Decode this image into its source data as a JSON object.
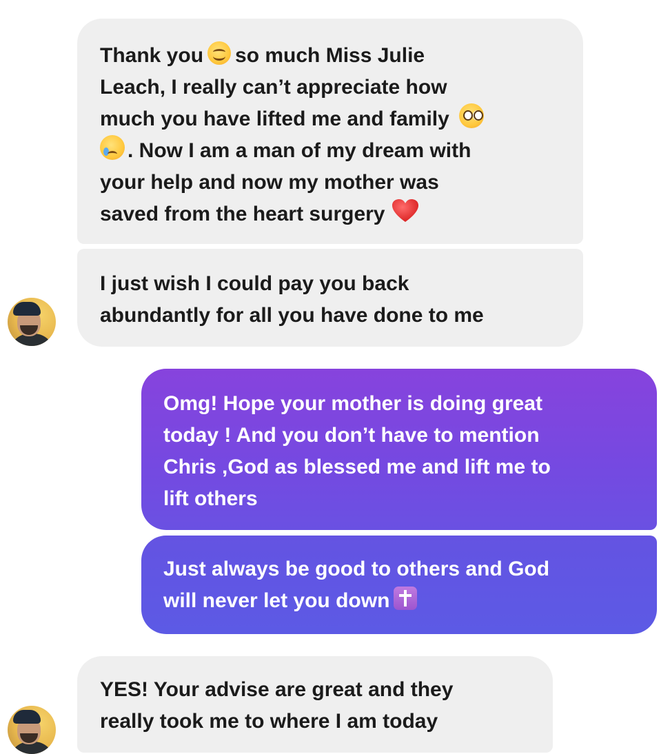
{
  "conversation": {
    "messages": [
      {
        "sender": "contact",
        "lines": [
          {
            "before": "Thank you",
            "after": "so much Miss Julie"
          },
          {
            "text": "Leach, I really can’t appreciate how"
          },
          {
            "text": "much you have lifted me and family"
          },
          {
            "text": ". Now I am a man of my dream with"
          },
          {
            "text": "your help and now my mother was"
          },
          {
            "text": "saved from the heart surgery"
          }
        ]
      },
      {
        "sender": "contact",
        "lines": [
          {
            "text": "I just wish I could pay you back"
          },
          {
            "text": "abundantly for all you have done to me"
          }
        ]
      },
      {
        "sender": "me",
        "lines": [
          {
            "text": "Omg! Hope your mother is doing great"
          },
          {
            "text": "today ! And you don’t have to mention"
          },
          {
            "text": "Chris ,God as blessed me and lift me to"
          },
          {
            "text": "lift others"
          }
        ]
      },
      {
        "sender": "me",
        "lines": [
          {
            "text": "Just always be good to others and God"
          },
          {
            "text": "will never let you down"
          }
        ]
      },
      {
        "sender": "contact",
        "lines": [
          {
            "text": "YES! Your advise are great and they"
          },
          {
            "text": "really took me to where I am today"
          }
        ]
      }
    ]
  },
  "emojis": {
    "m1_line1": "smiling-face-icon",
    "m1_line3": "pleading-face-icon",
    "m1_line4": "crying-face-icon",
    "m1_line6": "red-heart-icon",
    "m4_line2": "latin-cross-icon"
  },
  "colors": {
    "incoming_bubble": "#efefef",
    "incoming_text": "#1b1b1b",
    "outgoing_gradient_top": "#8743dd",
    "outgoing_gradient_bottom": "#5c5ae5",
    "outgoing_text": "#ffffff"
  }
}
